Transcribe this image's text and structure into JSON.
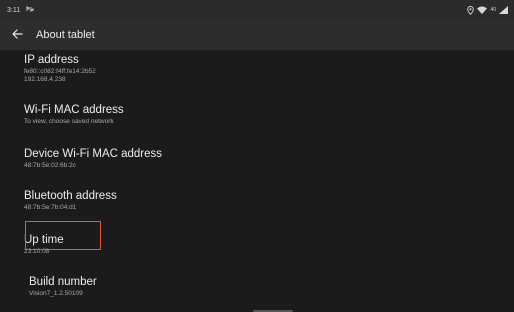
{
  "status_bar": {
    "time": "3:11",
    "notification_icon": "nfc-icon",
    "battery_level": "40"
  },
  "app_bar": {
    "title": "About tablet",
    "back_icon": "back-arrow-icon"
  },
  "items": [
    {
      "title": "IP address",
      "summary": [
        "fe80::c082:f4ff:fe14:2b52",
        "192.168.4.238"
      ]
    },
    {
      "title": "Wi-Fi MAC address",
      "summary": [
        "To view, choose saved network"
      ]
    },
    {
      "title": "Device Wi-Fi MAC address",
      "summary": [
        "48:7b:5e:02:6b:2c"
      ]
    },
    {
      "title": "Bluetooth address",
      "summary": [
        "48:7b:5e:7b:04:d1"
      ]
    },
    {
      "title": "Up time",
      "summary": [
        "23:10:08"
      ]
    },
    {
      "title": "Build number",
      "summary": [
        "Vision7_1.2.50109"
      ]
    }
  ],
  "colors": {
    "highlight": "#e05a3a",
    "background": "#1b1b1b",
    "app_bar": "#2d2d2d"
  }
}
